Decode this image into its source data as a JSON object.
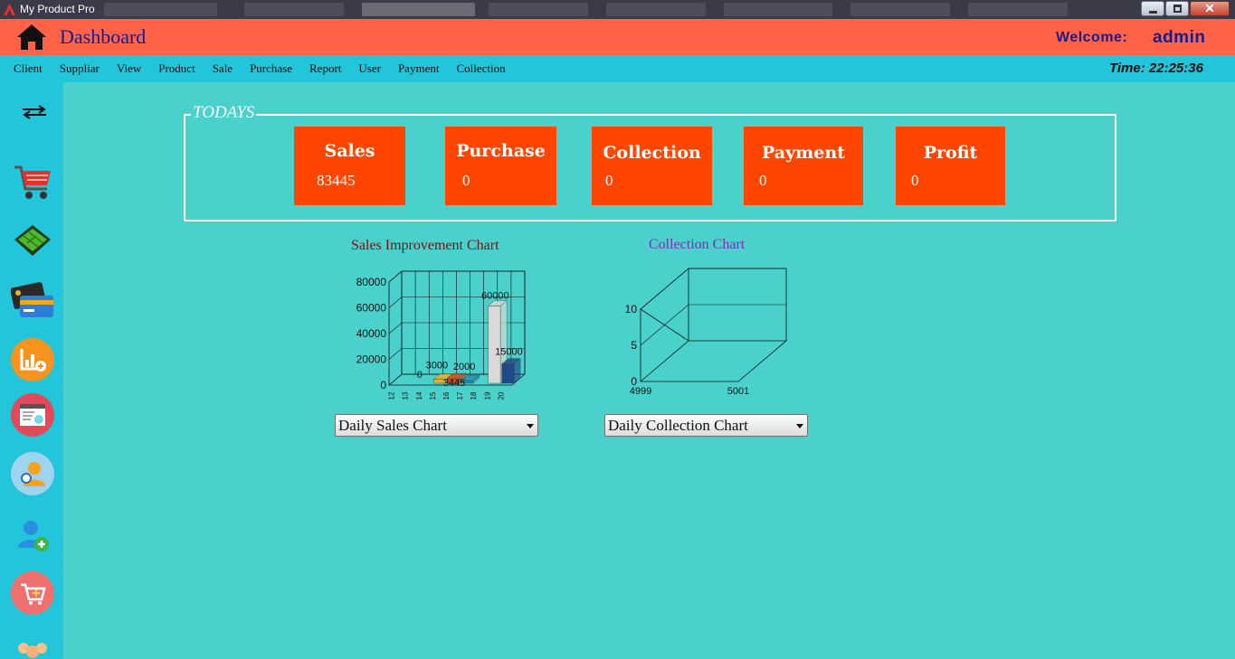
{
  "window": {
    "title": "My Product Pro"
  },
  "header": {
    "title": "Dashboard",
    "welcome_label": "Welcome:",
    "username": "admin"
  },
  "menu": [
    "Client",
    "Suppliar",
    "View",
    "Product",
    "Sale",
    "Purchase",
    "Report",
    "User",
    "Payment",
    "Collection"
  ],
  "clock": {
    "label": "Time:",
    "value": "22:25:36"
  },
  "sidebar": {
    "icons": [
      "swap-arrows-icon",
      "shopping-cart-icon",
      "money-basket-icon",
      "credit-cards-icon",
      "chart-add-icon",
      "calendar-report-icon",
      "user-settings-icon",
      "add-user-icon",
      "cart-add-icon",
      "users-group-icon"
    ]
  },
  "todays": {
    "legend": "TODAYS",
    "cards": [
      {
        "label": "Sales",
        "value": "83445"
      },
      {
        "label": "Purchase",
        "value": "0"
      },
      {
        "label": "Collection",
        "value": "0"
      },
      {
        "label": "Payment",
        "value": "0"
      },
      {
        "label": "Profit",
        "value": "0"
      }
    ]
  },
  "colors": {
    "header": "#ff6347",
    "menubar": "#22c5d9",
    "background": "#4ad1cc",
    "card": "#ff4500"
  },
  "chart_data": [
    {
      "type": "bar",
      "title": "Sales Improvement Chart",
      "categories": [
        "12",
        "13",
        "14",
        "15",
        "16",
        "17",
        "18",
        "19",
        "20"
      ],
      "values": [
        0,
        0,
        0,
        3000,
        3445,
        2000,
        0,
        60000,
        15000
      ],
      "data_labels": [
        "0",
        "3000",
        "3445",
        "2000",
        "60000",
        "15000"
      ],
      "ylim": [
        0,
        80000
      ],
      "yticks": [
        "0",
        "20000",
        "40000",
        "60000",
        "80000"
      ],
      "grid": true,
      "legend": false,
      "bar_colors": [
        "#e8b030",
        "#d24a1a",
        "#2b8fb0",
        "#d9d9d9",
        "#1e4a8a"
      ],
      "style": "3d"
    },
    {
      "type": "bar",
      "title": "Collection Chart",
      "categories": [
        "4999",
        "5001"
      ],
      "values": [
        0,
        0
      ],
      "ylim": [
        0,
        10
      ],
      "yticks": [
        "0",
        "5",
        "10"
      ],
      "grid": true,
      "legend": false,
      "style": "3d"
    }
  ],
  "selects": {
    "sales": "Daily Sales Chart",
    "collection": "Daily Collection Chart"
  }
}
